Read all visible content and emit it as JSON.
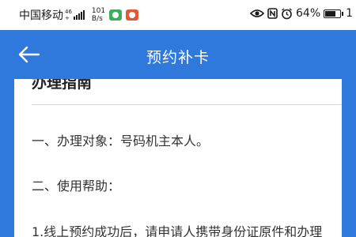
{
  "status_bar": {
    "carrier": "中国移动",
    "network_tag_top": "46",
    "network_tag_bottom": "+",
    "speed_value": "101",
    "speed_unit": "B/s",
    "battery": "64%",
    "time_partial": "1"
  },
  "nav": {
    "title": "预约补卡"
  },
  "content": {
    "section_heading": "办理指南",
    "paragraphs": [
      "一、办理对象：号码机主本人。",
      "二、使用帮助：",
      "1.线上预约成功后，请申请人携带身份证原件和办理"
    ]
  },
  "colors": {
    "primary": "#2f78dc",
    "page_bg": "#ffffff",
    "text": "#333333"
  },
  "icons": [
    "back-arrow-icon",
    "eye-icon",
    "nfc-icon",
    "alarm-icon",
    "battery-icon",
    "signal-icon"
  ]
}
